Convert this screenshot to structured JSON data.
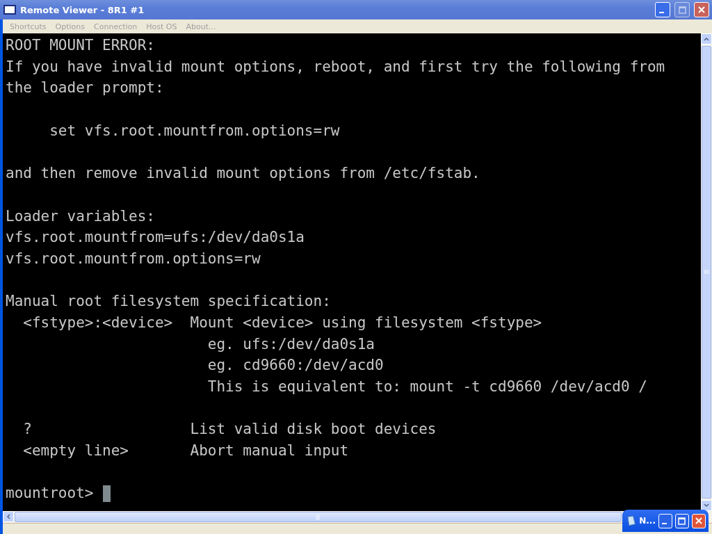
{
  "window": {
    "title": "Remote Viewer - 8R1 #1"
  },
  "menu": [
    "Shortcuts",
    "Options",
    "Connection",
    "Host OS",
    "About..."
  ],
  "console": {
    "paragraphs": [
      [
        "ROOT MOUNT ERROR:",
        "If you have invalid mount options, reboot, and first try the following from",
        "the loader prompt:"
      ],
      [
        "     set vfs.root.mountfrom.options=rw"
      ],
      [
        "and then remove invalid mount options from /etc/fstab."
      ],
      [
        "Loader variables:",
        "vfs.root.mountfrom=ufs:/dev/da0s1a",
        "vfs.root.mountfrom.options=rw"
      ],
      [
        "Manual root filesystem specification:",
        "  <fstype>:<device>  Mount <device> using filesystem <fstype>",
        "                       eg. ufs:/dev/da0s1a",
        "                       eg. cd9660:/dev/acd0",
        "                       This is equivalent to: mount -t cd9660 /dev/acd0 /"
      ],
      [
        "  ?                  List valid disk boot devices",
        "  <empty line>       Abort manual input"
      ]
    ],
    "prompt": "mountroot>"
  },
  "mini_window": {
    "title": "N..."
  }
}
